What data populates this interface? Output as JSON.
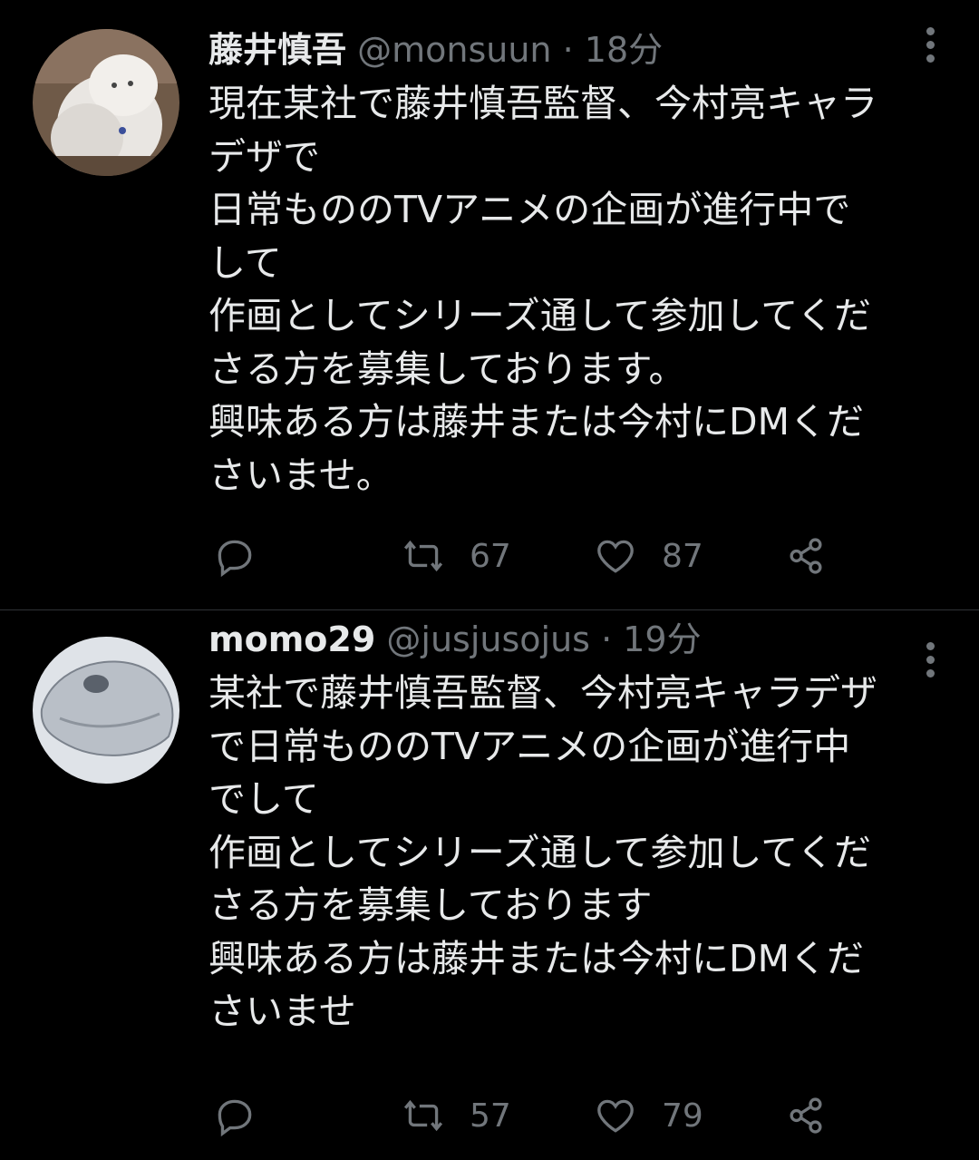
{
  "tweets": [
    {
      "name": "藤井慎吾",
      "handle": "@monsuun",
      "separator": "·",
      "time": "18分",
      "avatar_icon": "white-persian-cat-avatar",
      "text": "現在某社で藤井慎吾監督、今村亮キャラ\nデザで\n日常もののTVアニメの企画が進行中で\nして\n作画としてシリーズ通して参加してくだ\nさる方を募集しております。\n興味ある方は藤井または今村にDMくだ\nさいませ。",
      "retweets": "67",
      "likes": "87"
    },
    {
      "name": "momo29",
      "handle": "@jusjusojus",
      "separator": "·",
      "time": "19分",
      "avatar_icon": "sketch-creature-avatar",
      "text": "某社で藤井慎吾監督、今村亮キャラデザ\nで日常もののTVアニメの企画が進行中\nでして\n作画としてシリーズ通して参加してくだ\nさる方を募集しております\n興味ある方は藤井または今村にDMくだ\nさいませ",
      "retweets": "57",
      "likes": "79"
    }
  ],
  "colors": {
    "background": "#000000",
    "text": "#e7e9ea",
    "muted": "#71767b",
    "divider": "#2f3336"
  }
}
